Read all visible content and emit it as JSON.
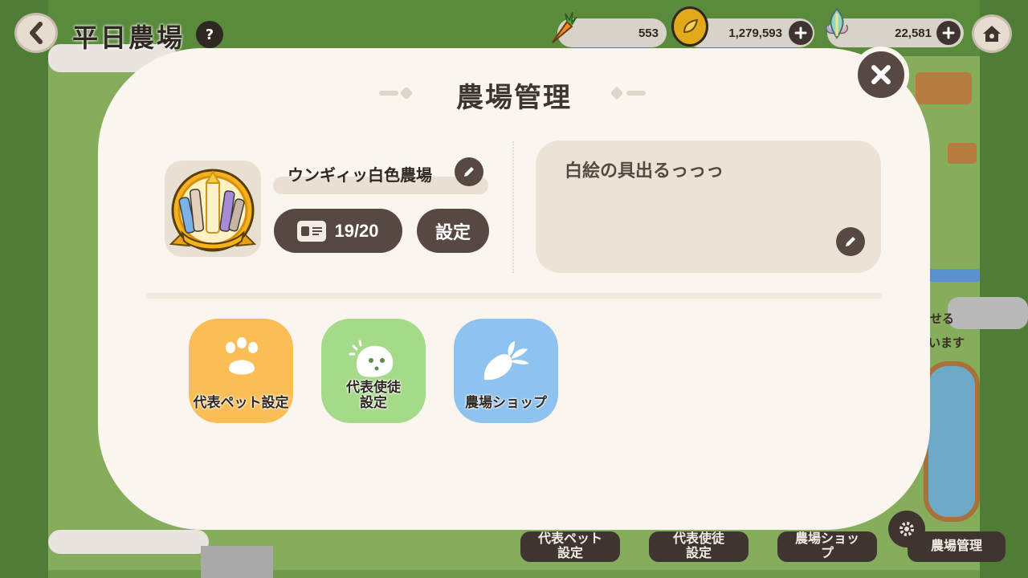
{
  "header": {
    "title": "平日農場",
    "help_icon": "?"
  },
  "currencies": [
    {
      "name": "carrot",
      "value": "553"
    },
    {
      "name": "coin",
      "value": "1,279,593"
    },
    {
      "name": "gem",
      "value": "22,581"
    }
  ],
  "modal": {
    "title": "農場管理",
    "farm_name": "ウンギィッ白色農場",
    "members": "19/20",
    "settings_label": "設定",
    "description": "白絵の具出るっっっ",
    "tiles": [
      {
        "label": "代表ペット設定",
        "icon": "paw-icon"
      },
      {
        "label": "代表使徒\n設定",
        "icon": "spirit-icon"
      },
      {
        "label": "農場ショップ",
        "icon": "radish-icon"
      }
    ]
  },
  "bottom_bar": {
    "pet": "代表ペット\n設定",
    "envoy": "代表使徒\n設定",
    "shop": "農場ショッ\nプ",
    "manage": "農場管理"
  },
  "background_text": {
    "t1": "せる",
    "t2": "います"
  },
  "colors": {
    "modal_bg": "#faf5ee",
    "dark_brown": "#574841",
    "tile_orange": "#fbbe56",
    "tile_green": "#a5da89",
    "tile_blue": "#8ec2ef"
  }
}
